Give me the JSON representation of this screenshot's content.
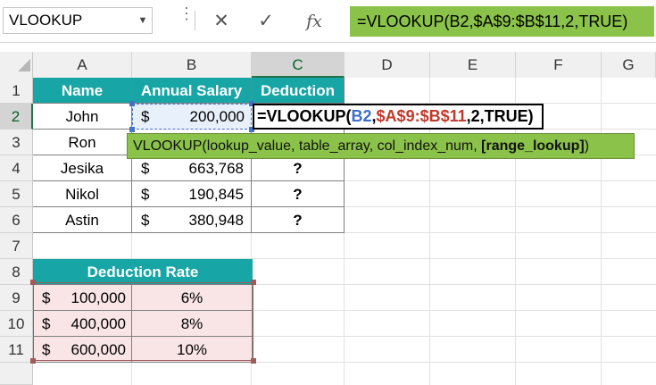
{
  "formula_bar": {
    "name_box": "VLOOKUP",
    "cancel_icon": "✕",
    "enter_icon": "✓",
    "fx_label": "fx",
    "formula": "=VLOOKUP(B2,$A$9:$B$11,2,TRUE)"
  },
  "columns": [
    "A",
    "B",
    "C",
    "D",
    "E",
    "F",
    "G"
  ],
  "rows": [
    "1",
    "2",
    "3",
    "4",
    "5",
    "6",
    "7",
    "8",
    "9",
    "10",
    "11"
  ],
  "table": {
    "headers": [
      "Name",
      "Annual Salary",
      "Deduction"
    ],
    "rows": [
      {
        "name": "John",
        "currency": "$",
        "salary": "200,000"
      },
      {
        "name": "Ron",
        "currency": "$",
        "salary": ""
      },
      {
        "name": "Jesika",
        "currency": "$",
        "salary": "663,768",
        "deduction": "?"
      },
      {
        "name": "Nikol",
        "currency": "$",
        "salary": "190,845",
        "deduction": "?"
      },
      {
        "name": "Astin",
        "currency": "$",
        "salary": "380,948",
        "deduction": "?"
      }
    ]
  },
  "edit_cell": {
    "prefix": "=VLOOKUP(",
    "ref1": "B2",
    "comma1": ",",
    "ref2": "$A$9:$B$11",
    "suffix": ",2,TRUE)"
  },
  "tooltip": {
    "prefix": "VLOOKUP(lookup_value, table_array, col_index_num, ",
    "bold_arg": "[range_lookup]",
    "suffix": ")"
  },
  "rate_table": {
    "header": "Deduction Rate",
    "rows": [
      {
        "currency": "$",
        "amount": "100,000",
        "rate": "6%"
      },
      {
        "currency": "$",
        "amount": "400,000",
        "rate": "8%"
      },
      {
        "currency": "$",
        "amount": "600,000",
        "rate": "10%"
      }
    ]
  },
  "colors": {
    "header_teal": "#17a5a5",
    "formula_green": "#8bc34a",
    "rate_pink": "#f9e5e6"
  }
}
